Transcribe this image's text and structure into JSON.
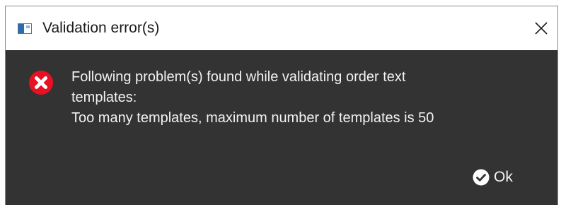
{
  "dialog": {
    "title": "Validation error(s)",
    "icon": "app-window-icon",
    "close_icon": "close-icon"
  },
  "message": {
    "line1": "Following problem(s) found while validating order text",
    "line2": "templates:",
    "line3": "Too many templates, maximum number of templates is 50",
    "icon": "error-icon"
  },
  "buttons": {
    "ok_label": "Ok",
    "ok_icon": "check-circle-icon"
  },
  "colors": {
    "body_background": "#333333",
    "error_icon": "#e81123",
    "text": "#f2f2f2"
  }
}
